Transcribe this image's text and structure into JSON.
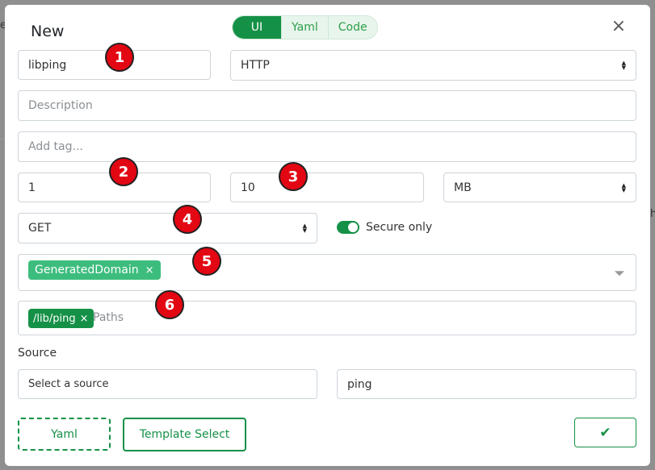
{
  "dialog": {
    "title": "New",
    "close_symbol": "×"
  },
  "mode_tabs": [
    {
      "label": "UI",
      "active": true
    },
    {
      "label": "Yaml",
      "active": false
    },
    {
      "label": "Code",
      "active": false
    }
  ],
  "form": {
    "name_value": "libping",
    "protocol_value": "HTTP",
    "description_placeholder": "Description",
    "tag_placeholder": "Add tag...",
    "count_value": "1",
    "size_value": "10",
    "unit_value": "MB",
    "method_value": "GET",
    "secure_only_label": "Secure only",
    "secure_only_on": true,
    "domain_chip": "GeneratedDomain",
    "path_chip": "/lib/ping",
    "paths_placeholder": "Paths",
    "source_label": "Source",
    "source_select_placeholder": "Select a source",
    "source_value": "ping",
    "chip_remove_symbol": "×"
  },
  "footer": {
    "yaml_button": "Yaml",
    "template_button": "Template Select",
    "confirm_icon": "✔"
  },
  "annotations": [
    "1",
    "2",
    "3",
    "4",
    "5",
    "6"
  ],
  "background": {
    "left_fragment": "e",
    "right_fragment": "h"
  },
  "colors": {
    "accent": "#159147",
    "chip_domain": "#3dbd7d",
    "badge": "#e30613"
  }
}
